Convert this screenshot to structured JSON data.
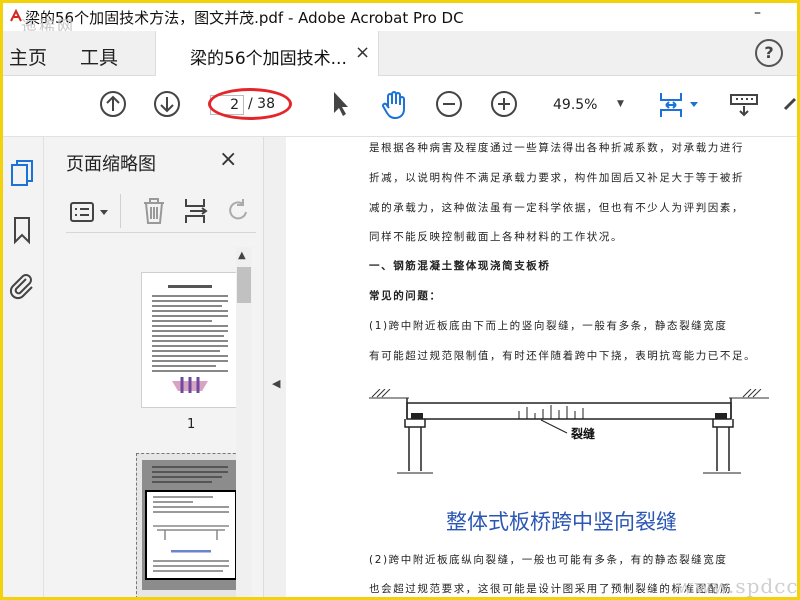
{
  "window": {
    "title": "梁的56个加固技术方法，图文并茂.pdf - Adobe Acrobat Pro DC",
    "minimize": "–",
    "watermark_tl": "迤稀网"
  },
  "tabs": {
    "home": "主页",
    "tools": "工具",
    "document": "梁的56个加固技术...",
    "close": "×",
    "help": "?"
  },
  "toolbar": {
    "page_current": "2",
    "page_total": "/ 38",
    "zoom": "49.5%",
    "icons": [
      "arrow-up-circle-icon",
      "arrow-down-circle-icon",
      "cursor-icon",
      "hand-icon",
      "zoom-out-icon",
      "zoom-in-icon",
      "fit-page-icon",
      "scroll-mode-icon",
      "sign-icon"
    ]
  },
  "panel": {
    "title": "页面缩略图",
    "close": "×",
    "thumbs": [
      {
        "label": "1",
        "heading": "梁的56个加固技术方法，图文并茂"
      },
      {
        "label": "",
        "caption": "整体式板桥跨中竖向裂缝"
      }
    ]
  },
  "document": {
    "lines": [
      {
        "text": "是根据各种病害及程度通过一些算法得出各种折减系数，对承载力进行",
        "bold": false
      },
      {
        "text": "折减，以说明构件不满足承载力要求，构件加固后又补足大于等于被折",
        "bold": false
      },
      {
        "text": "减的承载力，这种做法虽有一定科学依据，但也有不少人为评判因素，",
        "bold": false
      },
      {
        "text": "同样不能反映控制截面上各种材料的工作状况。",
        "bold": false
      },
      {
        "text": "    一、钢筋混凝土整体现浇简支板桥",
        "bold": true
      },
      {
        "text": "    常见的问题：",
        "bold": true
      },
      {
        "text": "    (1)跨中附近板底由下而上的竖向裂缝，一般有多条，静态裂缝宽度",
        "bold": false
      },
      {
        "text": "有可能超过规范限制值，有时还伴随着跨中下挠，表明抗弯能力已不足。",
        "bold": false
      }
    ],
    "diagram_label": "裂缝",
    "figure_caption": "整体式板桥跨中竖向裂缝",
    "lines_after": [
      {
        "text": "    (2)跨中附近板底纵向裂缝，一般也可能有多条，有的静态裂缝宽度",
        "bold": false
      },
      {
        "text": "也会超过规范要求，这很可能是设计图采用了预制裂缝的标准图配筋",
        "bold": false
      }
    ],
    "watermark": "www.spdcc.com"
  },
  "colors": {
    "frame": "#f4d20b",
    "accent_blue": "#1c72d6",
    "highlight_red": "#e4262a",
    "caption_blue": "#2b56b4"
  }
}
